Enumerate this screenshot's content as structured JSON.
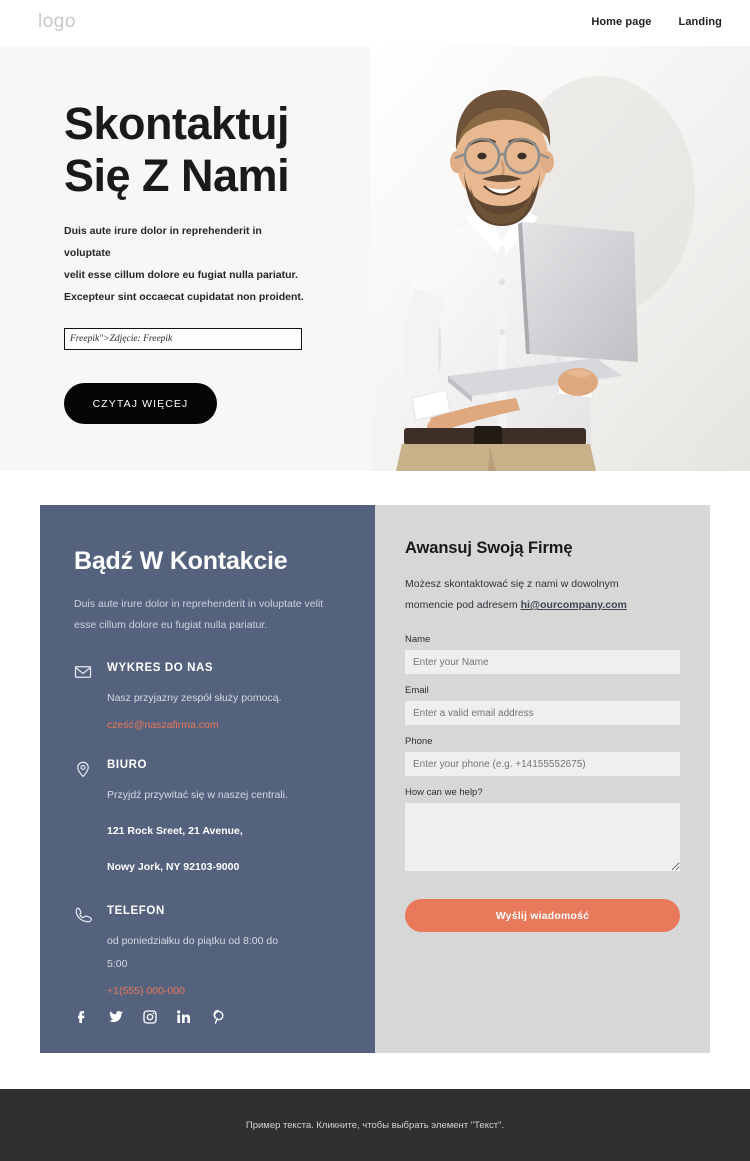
{
  "header": {
    "logo": "logo",
    "nav": [
      {
        "label": "Home page"
      },
      {
        "label": "Landing"
      }
    ]
  },
  "hero": {
    "title_line1": "Skontaktuj",
    "title_line2": "Się Z Nami",
    "paragraph_line1": "Duis aute irure dolor in reprehenderit in voluptate",
    "paragraph_line2": "velit esse cillum dolore eu fugiat nulla pariatur.",
    "paragraph_line3": "Excepteur sint occaecat cupidatat non proident.",
    "credit_field_value": "Freepik\">Zdjęcie: Freepik",
    "cta_label": "CZYTAJ WIĘCEJ",
    "photo_alt": "smiling-man-with-glasses-holding-laptop"
  },
  "contact_panel": {
    "heading": "Bądź W Kontakcie",
    "intro_line1": "Duis aute irure dolor in reprehenderit in voluptate velit",
    "intro_line2": "esse cillum dolore eu fugiat nulla pariatur.",
    "blocks": [
      {
        "icon": "envelope-icon",
        "title": "WYKRES DO NAS",
        "lines": [
          "Nasz przyjazny zespół służy pomocą."
        ],
        "bold_lines": [],
        "accent_value": "cześć@naszafirma.com"
      },
      {
        "icon": "map-pin-icon",
        "title": "BIURO",
        "lines": [
          "Przyjdź przywitać się w naszej centrali."
        ],
        "bold_lines": [
          "121 Rock Sreet, 21 Avenue,",
          "Nowy Jork, NY 92103-9000"
        ],
        "accent_value": ""
      },
      {
        "icon": "phone-icon",
        "title": "TELEFON",
        "lines": [
          "od poniedziałku do piątku od 8:00 do",
          "5:00"
        ],
        "bold_lines": [],
        "accent_value": "+1(555) 000-000"
      }
    ],
    "socials": [
      {
        "name": "facebook-icon",
        "glyph": "f"
      },
      {
        "name": "twitter-icon",
        "glyph": "twitter"
      },
      {
        "name": "instagram-icon",
        "glyph": "instagram"
      },
      {
        "name": "linkedin-icon",
        "glyph": "in"
      },
      {
        "name": "pinterest-icon",
        "glyph": "P"
      }
    ]
  },
  "form_panel": {
    "heading": "Awansuj Swoją Firmę",
    "lede_text_1": "Możesz skontaktować się z nami w dowolnym",
    "lede_text_2": "momencie pod adresem ",
    "lede_link": "hi@ourcompany.com",
    "fields": [
      {
        "label": "Name",
        "placeholder": "Enter your Name",
        "value": ""
      },
      {
        "label": "Email",
        "placeholder": "Enter a valid email address",
        "value": ""
      },
      {
        "label": "Phone",
        "placeholder": "Enter your phone (e.g. +14155552675)",
        "value": ""
      }
    ],
    "message_label": "How can we help?",
    "message_placeholder": "",
    "message_value": "",
    "submit_label": "Wyślij wiadomość"
  },
  "footer": {
    "text": "Пример текста. Кликните, чтобы выбрать элемент \"Текст\"."
  },
  "colors": {
    "hero_bg": "#f8f7f5",
    "panel_blue": "#55627d",
    "panel_gray": "#d7d7d7",
    "accent": "#e8795a",
    "footer_bg": "#303030",
    "dark_button": "#050505"
  }
}
